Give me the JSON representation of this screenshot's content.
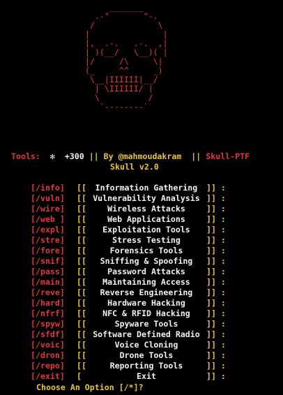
{
  "skull_art": "      _______\n   .-\"       \"-.\n  /             \\\n |               |\n |,  .-.   .-.  ,|\n | )(__/   \\__)( |\n |/     /\\     \\|\n (_     ^^     _)\n  \\__|IIIIII|__/\n   | \\IIIIII/ |\n   \\          /\n    `--------`",
  "header": {
    "tools_label": "Tools:",
    "star_icon": "✻",
    "count": "+300",
    "sep1": " || ",
    "by_text": "By @mahmoudakram",
    "sep2": "  || ",
    "name": "Skull-PTF",
    "version": "Skull v2.0"
  },
  "menu": [
    {
      "key": "[/info]",
      "label": "Information Gathering",
      "close": "]] :"
    },
    {
      "key": "[/vuln]",
      "label": "Vulnerability Analysis",
      "close": "]] :"
    },
    {
      "key": "[/wire]",
      "label": "Wireless Attacks",
      "close": "]] :"
    },
    {
      "key": "[/web ]",
      "label": "Web Applications",
      "close": "]] :"
    },
    {
      "key": "[/expl]",
      "label": "Exploitation Tools",
      "close": "]] :"
    },
    {
      "key": "[/stre]",
      "label": "Stress Testing",
      "close": "]] :"
    },
    {
      "key": "[/fore]",
      "label": "Forensics Tools",
      "close": "]] :"
    },
    {
      "key": "[/snif]",
      "label": "Sniffing & Spoofing",
      "close": "]] :"
    },
    {
      "key": "[/pass]",
      "label": "Password Attacks",
      "close": "]] :"
    },
    {
      "key": "[/main]",
      "label": "Maintaining Access",
      "close": "]] :"
    },
    {
      "key": "[/reve]",
      "label": "Reverse Engineering",
      "close": "]] :"
    },
    {
      "key": "[/hard]",
      "label": "Hardware Hacking",
      "close": "]] :"
    },
    {
      "key": "[/nfrf]",
      "label": "NFC & RFID Hacking",
      "close": "]] :"
    },
    {
      "key": "[/spyw]",
      "label": "Spyware Tools",
      "close": "]] :"
    },
    {
      "key": "[/sfdf]",
      "label": "Software Defined Radio",
      "close": "]] :"
    },
    {
      "key": "[/voic]",
      "label": "Voice Cloning",
      "close": "]] :"
    },
    {
      "key": "[/dron]",
      "label": "Drone Tools",
      "close": "]] :"
    },
    {
      "key": "[/repo]",
      "label": "Reporting Tools",
      "close": "]] :"
    },
    {
      "key": "[/exit]",
      "label": "Exit",
      "close": "]] :"
    }
  ],
  "prompt": "Choose An Option [/*]?",
  "colors": {
    "background": "#000000",
    "red": "#e0383e",
    "yellow": "#e8c43a",
    "white": "#f2f2f2"
  }
}
